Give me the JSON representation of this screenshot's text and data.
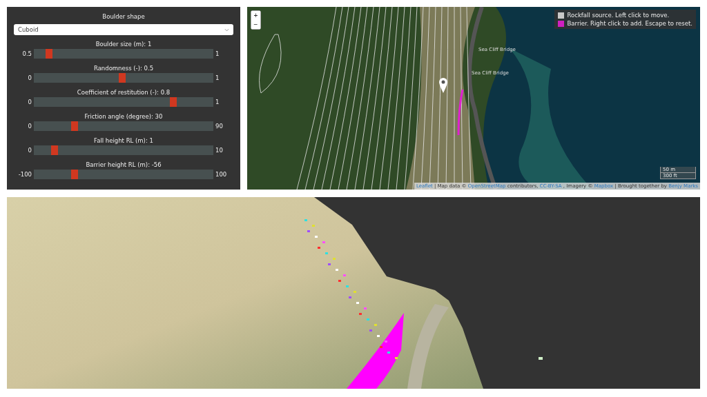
{
  "controls": {
    "shape": {
      "label": "Boulder shape",
      "value": "Cuboid"
    },
    "sliders": [
      {
        "label": "Boulder size (m): 1",
        "min": "0.5",
        "max": "1",
        "level": 0.07
      },
      {
        "label": "Randomness (-): 0.5",
        "min": "0",
        "max": "1",
        "level": 0.5
      },
      {
        "label": "Coefficient of restitution (-): 0.8",
        "min": "0",
        "max": "1",
        "level": 0.8
      },
      {
        "label": "Friction angle (degree): 30",
        "min": "0",
        "max": "90",
        "level": 0.22
      },
      {
        "label": "Fall height RL (m): 1",
        "min": "0",
        "max": "10",
        "level": 0.1
      },
      {
        "label": "Barrier height RL (m): -56",
        "min": "-100",
        "max": "100",
        "level": 0.22
      }
    ]
  },
  "map": {
    "zoom_buttons": [
      "+",
      "−"
    ],
    "legend": [
      {
        "label": "Rockfall source. Left click to move.",
        "color": "#c8c8c8"
      },
      {
        "label": "Barrier. Right click to add. Escape to reset.",
        "color": "#d020c0"
      }
    ],
    "place_labels": [
      "Sea Cliff Bridge",
      "Sea Cliff Bridge"
    ],
    "scale": [
      "50 m",
      "300 ft"
    ],
    "attribution": [
      {
        "kind": "link",
        "text": "Leaflet"
      },
      {
        "kind": "text",
        "text": "| Map data ©"
      },
      {
        "kind": "link",
        "text": "OpenStreetMap"
      },
      {
        "kind": "text",
        "text": "contributors,"
      },
      {
        "kind": "link",
        "text": "CC-BY-SA"
      },
      {
        "kind": "text",
        "text": ", Imagery ©"
      },
      {
        "kind": "link",
        "text": "Mapbox"
      },
      {
        "kind": "text",
        "text": "| Brought together by"
      },
      {
        "kind": "link",
        "text": "Benjy Marks"
      }
    ]
  }
}
